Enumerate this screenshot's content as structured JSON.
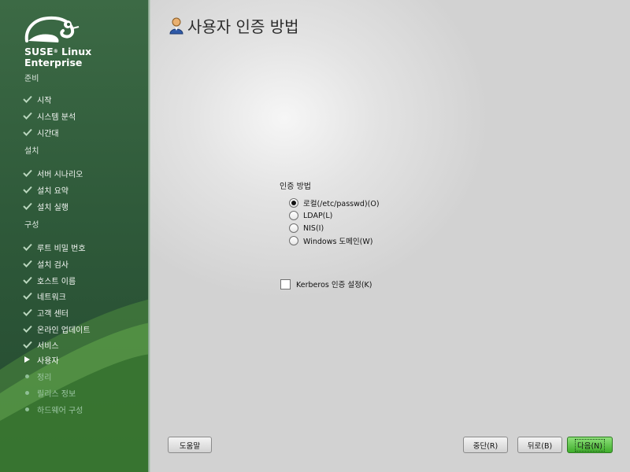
{
  "sidebar": {
    "brand_line1": "SUSE",
    "brand_reg": "®",
    "brand_line1b": " Linux",
    "brand_line2": "Enterprise",
    "sections": {
      "prep": "준비",
      "install": "설치",
      "config": "구성"
    },
    "steps": [
      {
        "label": "시작",
        "state": "done"
      },
      {
        "label": "시스템 분석",
        "state": "done"
      },
      {
        "label": "시간대",
        "state": "done"
      },
      {
        "label": "서버 시나리오",
        "state": "done"
      },
      {
        "label": "설치 요약",
        "state": "done"
      },
      {
        "label": "설치 실행",
        "state": "done"
      },
      {
        "label": "루트 비밀 번호",
        "state": "done"
      },
      {
        "label": "설치 검사",
        "state": "done"
      },
      {
        "label": "호스트 이름",
        "state": "done"
      },
      {
        "label": "네트워크",
        "state": "done"
      },
      {
        "label": "고객 센터",
        "state": "done"
      },
      {
        "label": "온라인 업데이트",
        "state": "done"
      },
      {
        "label": "서비스",
        "state": "done"
      },
      {
        "label": "사용자",
        "state": "current"
      },
      {
        "label": "정리",
        "state": "pending"
      },
      {
        "label": "릴리스 정보",
        "state": "pending"
      },
      {
        "label": "하드웨어 구성",
        "state": "pending"
      }
    ]
  },
  "main": {
    "title": "사용자 인증 방법",
    "group_label": "인증 방법",
    "options": [
      {
        "label": "로컬(/etc/passwd)(O)",
        "selected": true
      },
      {
        "label": "LDAP(L)",
        "selected": false
      },
      {
        "label": "NIS(I)",
        "selected": false
      },
      {
        "label": "Windows 도메인(W)",
        "selected": false
      }
    ],
    "kerberos_label": "Kerberos 인증 설정(K)",
    "kerberos_checked": false
  },
  "buttons": {
    "help": "도움말",
    "abort": "중단(R)",
    "back": "뒤로(B)",
    "next": "다음(N)"
  },
  "colors": {
    "sidebar_green": "#2f5a3a",
    "next_button": "#3fae2c"
  }
}
